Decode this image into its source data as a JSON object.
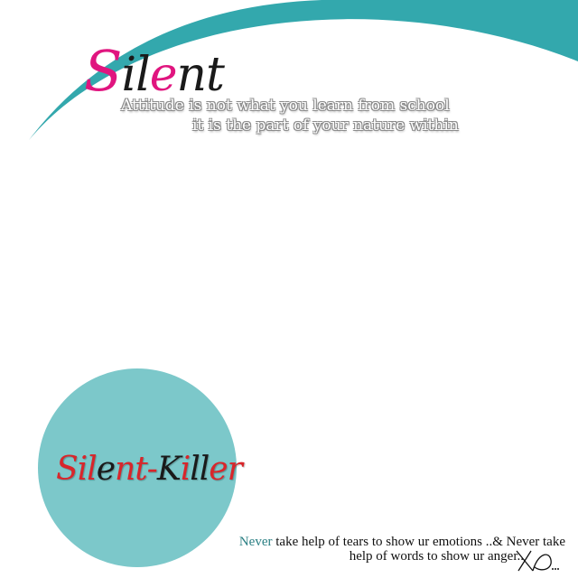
{
  "colors": {
    "teal_arc": "#33A8AD",
    "circle_fill": "#7CC8CA",
    "pink": "#E0157F",
    "dark": "#1A1A1A",
    "red": "#D8262B",
    "caption_accent": "#2A7F83"
  },
  "title": {
    "parts": [
      {
        "text": "S",
        "color": "#E0157F"
      },
      {
        "text": "i",
        "color": "#1A1A1A"
      },
      {
        "text": "l",
        "color": "#1A1A1A"
      },
      {
        "text": "e",
        "color": "#E0157F"
      },
      {
        "text": "n",
        "color": "#1A1A1A"
      },
      {
        "text": "t",
        "color": "#1A1A1A"
      }
    ]
  },
  "quote": {
    "line1": "Attitude is not what you learn from school",
    "line2": "it is the part of your nature within"
  },
  "logo": {
    "parts": [
      {
        "text": "Sil",
        "color": "#D8262B"
      },
      {
        "text": "e",
        "color": "#1A1A1A"
      },
      {
        "text": "nt-",
        "color": "#D8262B"
      },
      {
        "text": "K",
        "color": "#1A1A1A"
      },
      {
        "text": "i",
        "color": "#D8262B"
      },
      {
        "text": "ll",
        "color": "#1A1A1A"
      },
      {
        "text": "er",
        "color": "#D8262B"
      }
    ]
  },
  "caption": {
    "accent_word": "Never",
    "line1_rest": " take help of tears to show ur emotions  ..& Never take",
    "line2": "help of words to show ur anger.."
  },
  "signature": {
    "icon": "signature-xd"
  }
}
